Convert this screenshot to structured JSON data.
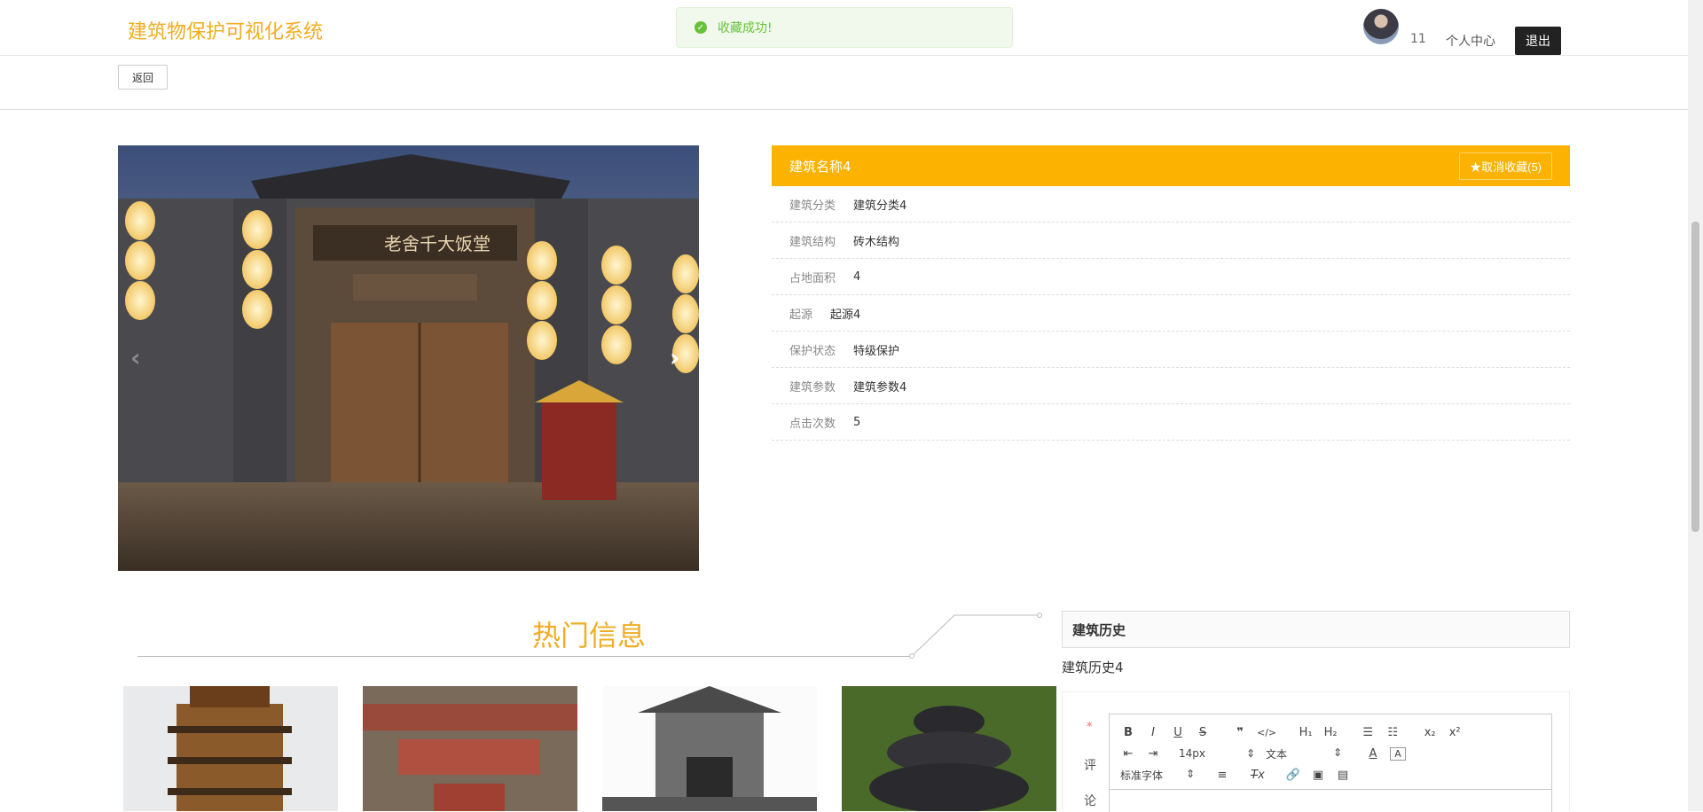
{
  "header": {
    "site_title": "建筑物保护可视化系统",
    "toast": "收藏成功!",
    "user_name": "11",
    "personal_center": "个人中心",
    "logout": "退出"
  },
  "back_button": "返回",
  "detail": {
    "name": "建筑名称4",
    "favorite_button": "★取消收藏(5)",
    "rows": [
      {
        "label": "建筑分类",
        "value": "建筑分类4"
      },
      {
        "label": "建筑结构",
        "value": "砖木结构"
      },
      {
        "label": "占地面积",
        "value": "4"
      },
      {
        "label": "起源",
        "value": "起源4"
      },
      {
        "label": "保护状态",
        "value": "特级保护"
      },
      {
        "label": "建筑参数",
        "value": "建筑参数4"
      },
      {
        "label": "点击次数",
        "value": "5"
      }
    ]
  },
  "carousel": {
    "signboard": "老舍千大饭堂",
    "prev_icon": "chevron-left-icon",
    "next_icon": "chevron-right-icon"
  },
  "hot": {
    "title": "热门信息"
  },
  "history": {
    "title": "建筑历史",
    "text": "建筑历史4"
  },
  "comment": {
    "required_mark": "*",
    "label_chars": [
      "评",
      "论"
    ],
    "font_size": "14px",
    "text_type": "文本",
    "font_family": "标准字体"
  },
  "colors": {
    "accent": "#fbb201",
    "title": "#f0ad23",
    "toast_bg": "#f0f9eb",
    "toast_text": "#67c23a"
  }
}
